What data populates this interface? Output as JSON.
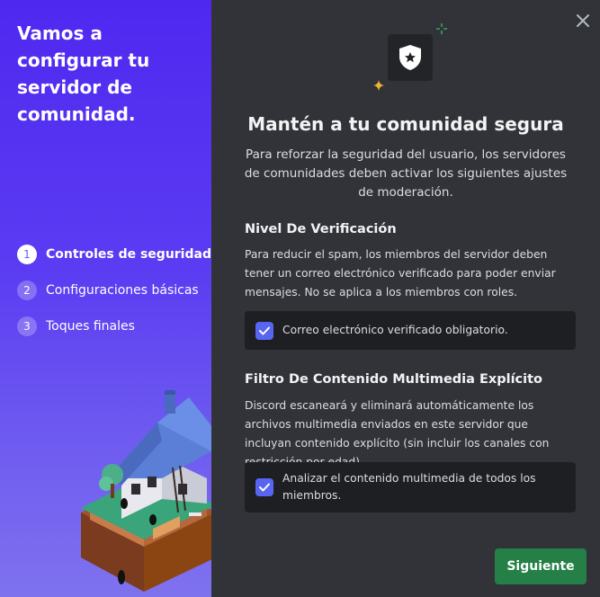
{
  "sidebar": {
    "title": "Vamos a configurar tu servidor de comunidad.",
    "steps": [
      {
        "number": "1",
        "label": "Controles de seguridad"
      },
      {
        "number": "2",
        "label": "Configuraciones básicas"
      },
      {
        "number": "3",
        "label": "Toques finales"
      }
    ],
    "active_step": 1
  },
  "main": {
    "heading": "Mantén a tu comunidad segura",
    "subheading": "Para reforzar la seguridad del usuario, los servidores de comunidades deben activar los siguientes ajustes de moderación.",
    "verification": {
      "title": "Nivel De Verificación",
      "description": "Para reducir el spam, los miembros del servidor deben tener un correo electrónico verificado para poder enviar mensajes. No se aplica a los miembros con roles.",
      "checkbox_label": "Correo electrónico verificado obligatorio.",
      "checked": true
    },
    "content_filter": {
      "title": "Filtro De Contenido Multimedia Explícito",
      "description": "Discord escaneará y eliminará automáticamente los archivos multimedia enviados en este servidor que incluyan contenido explícito (sin incluir los canales con restricción por edad).",
      "checkbox_label": "Analizar el contenido multimedia de todos los miembros.",
      "checked": true
    },
    "next_button": "Siguiente"
  },
  "icons": {
    "close": "close-icon",
    "hero": "shield-star-icon",
    "check": "check-icon"
  },
  "colors": {
    "accent": "#5865f2",
    "success": "#248046",
    "background": "#313338",
    "panel_dark": "#1e1f22",
    "sidebar_top": "#4f28f0"
  }
}
